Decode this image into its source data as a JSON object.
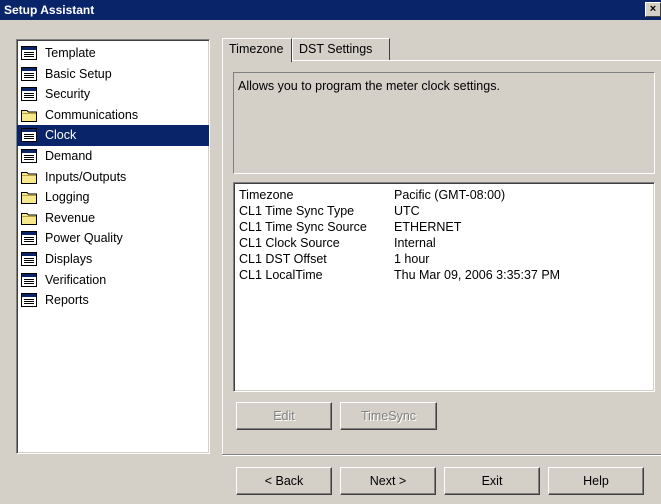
{
  "window": {
    "title": "Setup Assistant",
    "close_glyph": "×"
  },
  "tree": {
    "items": [
      {
        "label": "Template",
        "icon": "doc-icon"
      },
      {
        "label": "Basic Setup",
        "icon": "doc-icon"
      },
      {
        "label": "Security",
        "icon": "doc-icon"
      },
      {
        "label": "Communications",
        "icon": "folder-icon"
      },
      {
        "label": "Clock",
        "icon": "doc-icon",
        "selected": true
      },
      {
        "label": "Demand",
        "icon": "doc-icon"
      },
      {
        "label": "Inputs/Outputs",
        "icon": "folder-icon"
      },
      {
        "label": "Logging",
        "icon": "folder-icon"
      },
      {
        "label": "Revenue",
        "icon": "folder-icon"
      },
      {
        "label": "Power Quality",
        "icon": "doc-icon"
      },
      {
        "label": "Displays",
        "icon": "doc-icon"
      },
      {
        "label": "Verification",
        "icon": "doc-icon"
      },
      {
        "label": "Reports",
        "icon": "doc-icon"
      }
    ]
  },
  "tabs": {
    "timezone": "Timezone",
    "dst_settings": "DST Settings"
  },
  "description": "Allows you to program the meter clock settings.",
  "settings": [
    {
      "key": "Timezone",
      "value": "Pacific (GMT-08:00)"
    },
    {
      "key": "CL1 Time Sync Type",
      "value": "UTC"
    },
    {
      "key": "CL1 Time Sync Source",
      "value": "ETHERNET"
    },
    {
      "key": "CL1 Clock Source",
      "value": "Internal"
    },
    {
      "key": "CL1 DST Offset",
      "value": "1 hour"
    },
    {
      "key": "CL1 LocalTime",
      "value": "Thu Mar 09, 2006 3:35:37 PM"
    }
  ],
  "panel_buttons": {
    "edit": "Edit",
    "timesync": "TimeSync"
  },
  "nav_buttons": {
    "back": "< Back",
    "next": "Next >",
    "exit": "Exit",
    "help": "Help"
  }
}
